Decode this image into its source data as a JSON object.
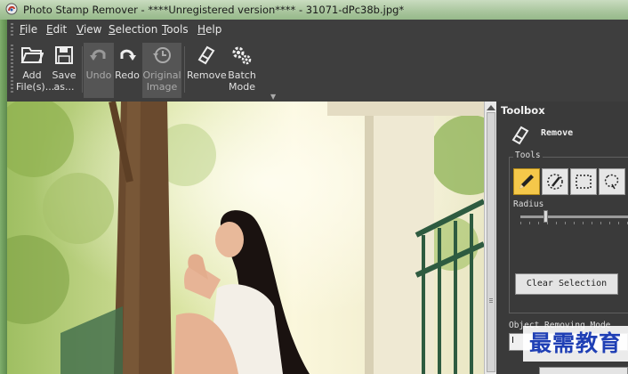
{
  "window": {
    "title": "Photo Stamp Remover - ****Unregistered version**** - 31071-dPc38b.jpg*"
  },
  "menu": {
    "items": [
      {
        "label": "File",
        "accel": "F"
      },
      {
        "label": "Edit",
        "accel": "E"
      },
      {
        "label": "View",
        "accel": "V"
      },
      {
        "label": "Selection",
        "accel": "S"
      },
      {
        "label": "Tools",
        "accel": "T"
      },
      {
        "label": "Help",
        "accel": "H"
      }
    ]
  },
  "toolbar": {
    "add_files": {
      "line1": "Add",
      "line2": "File(s)...",
      "icon": "folder-open-icon"
    },
    "save_as": {
      "line1": "Save",
      "line2": "as...",
      "icon": "floppy-disk-icon"
    },
    "undo": {
      "line1": "Undo",
      "icon": "undo-icon"
    },
    "redo": {
      "line1": "Redo",
      "icon": "redo-icon"
    },
    "original_image": {
      "line1": "Original",
      "line2": "Image",
      "icon": "history-clock-icon"
    },
    "remove": {
      "line1": "Remove",
      "icon": "eraser-icon"
    },
    "batch_mode": {
      "line1": "Batch",
      "line2": "Mode",
      "icon": "gears-icon"
    }
  },
  "toolbox": {
    "title": "Toolbox",
    "remove_label": "Remove",
    "tools_group": "Tools",
    "tools": [
      {
        "name": "pencil",
        "icon": "pencil-icon",
        "active": true
      },
      {
        "name": "magic-wand",
        "icon": "magic-wand-icon",
        "active": false
      },
      {
        "name": "rectangle-selection",
        "icon": "rectangle-selection-icon",
        "active": false
      },
      {
        "name": "lasso",
        "icon": "lasso-icon",
        "active": false
      }
    ],
    "radius_label": "Radius",
    "clear_selection": "Clear Selection",
    "mode_label": "Object Removing Mode",
    "mode_value": "I"
  },
  "watermark": {
    "text": "最需教育"
  },
  "colors": {
    "panel_bg": "#3a3a3a",
    "active_tool": "#f5c84a",
    "watermark_text": "#1f3fb5"
  }
}
